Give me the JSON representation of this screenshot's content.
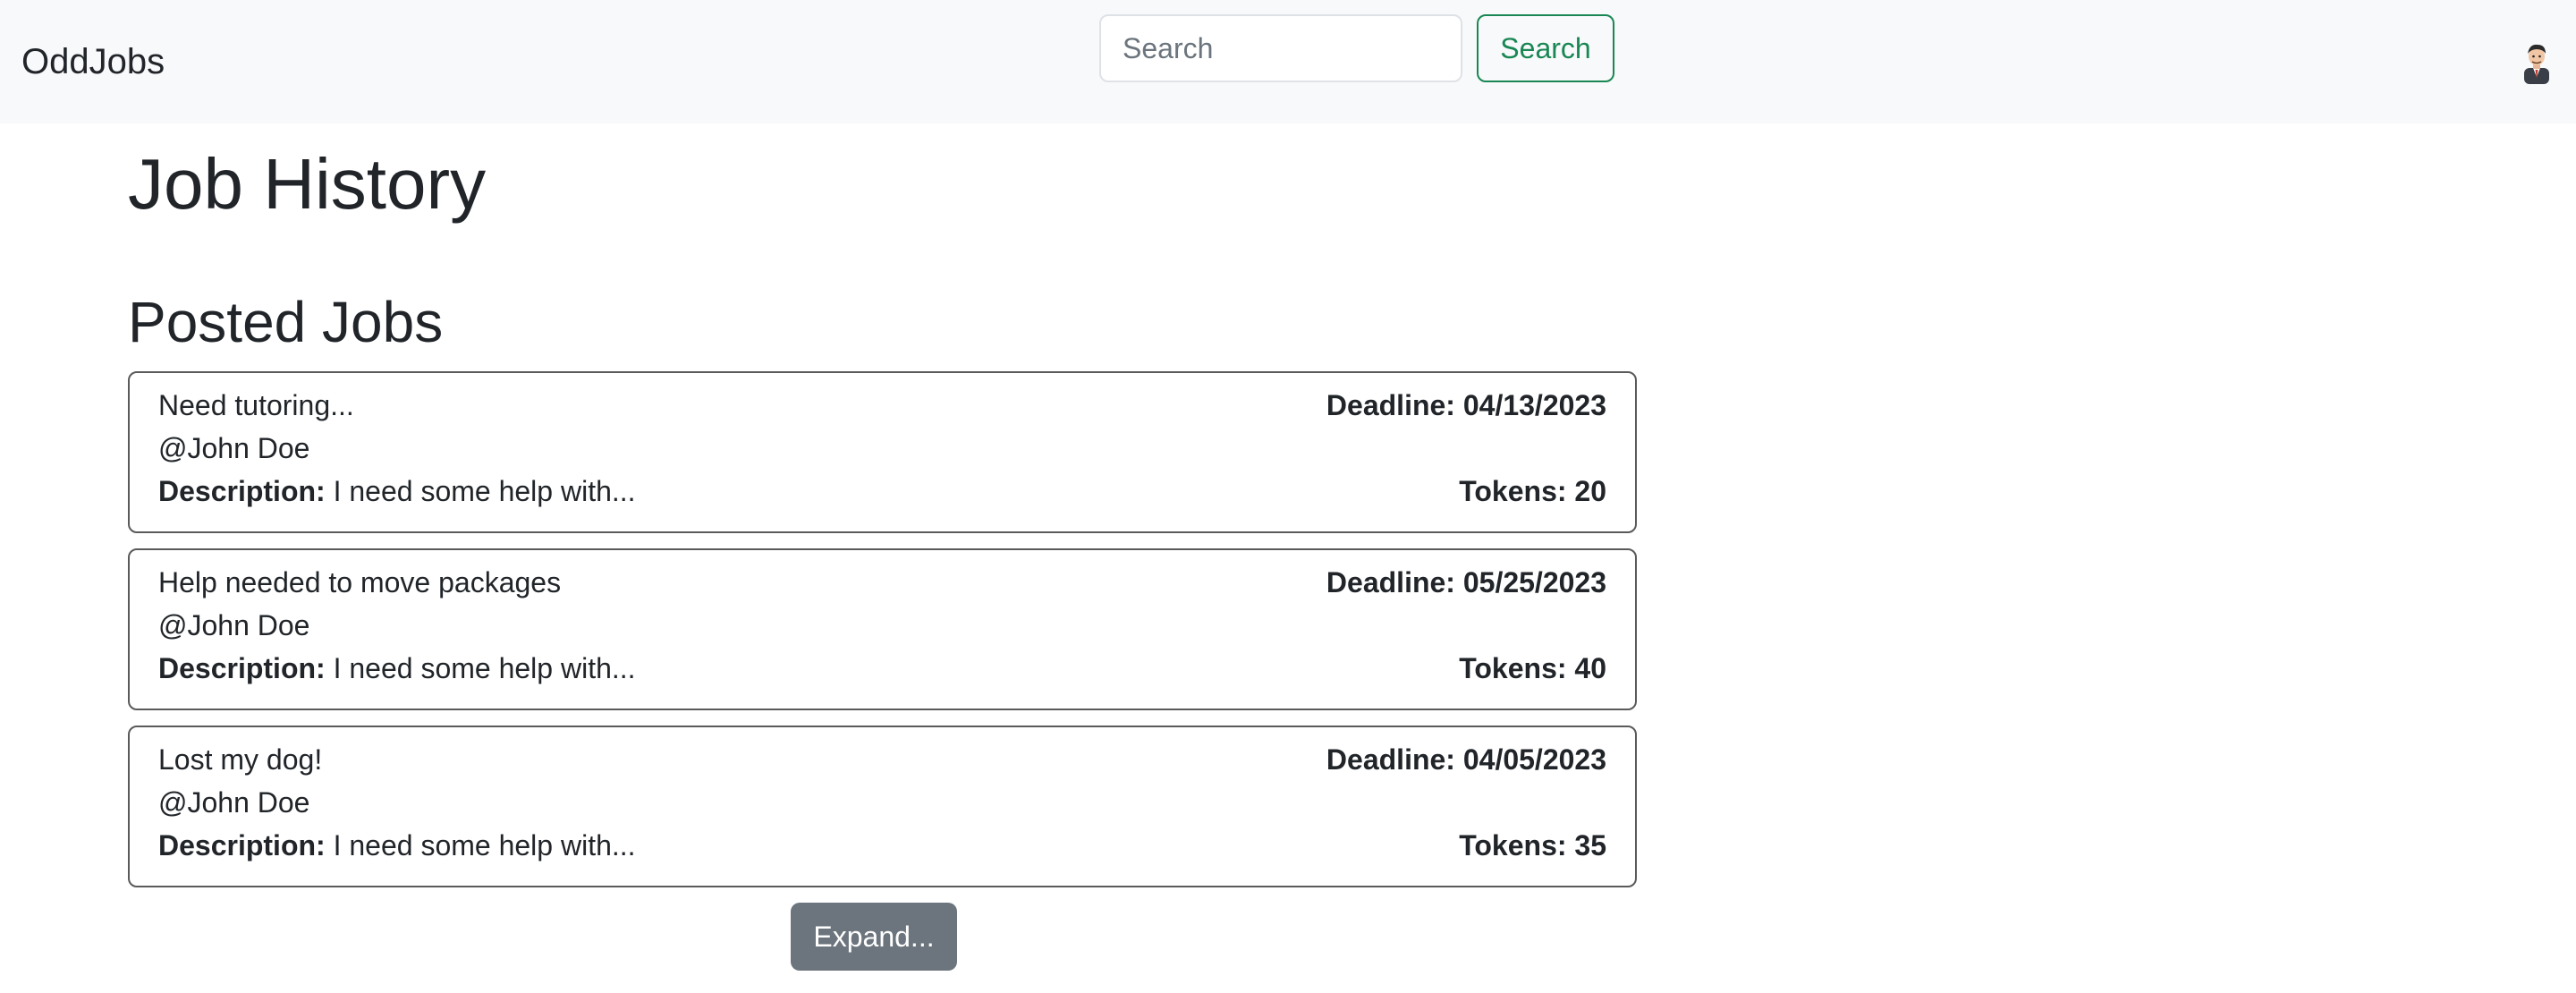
{
  "navbar": {
    "brand": "OddJobs",
    "search_placeholder": "Search",
    "search_value": "",
    "search_button_label": "Search",
    "avatar_icon": "user-avatar-icon"
  },
  "page": {
    "title": "Job History",
    "section_title": "Posted Jobs",
    "expand_label": "Expand..."
  },
  "jobs": [
    {
      "title": "Need tutoring...",
      "user": "@John Doe",
      "description_label": "Description:",
      "description": " I need some help with...",
      "deadline": "Deadline: 04/13/2023",
      "tokens": "Tokens: 20"
    },
    {
      "title": "Help needed to move packages",
      "user": "@John Doe",
      "description_label": "Description:",
      "description": " I need some help with...",
      "deadline": "Deadline: 05/25/2023",
      "tokens": "Tokens: 40"
    },
    {
      "title": "Lost my dog!",
      "user": "@John Doe",
      "description_label": "Description:",
      "description": " I need some help with...",
      "deadline": "Deadline: 04/05/2023",
      "tokens": "Tokens: 35"
    }
  ]
}
